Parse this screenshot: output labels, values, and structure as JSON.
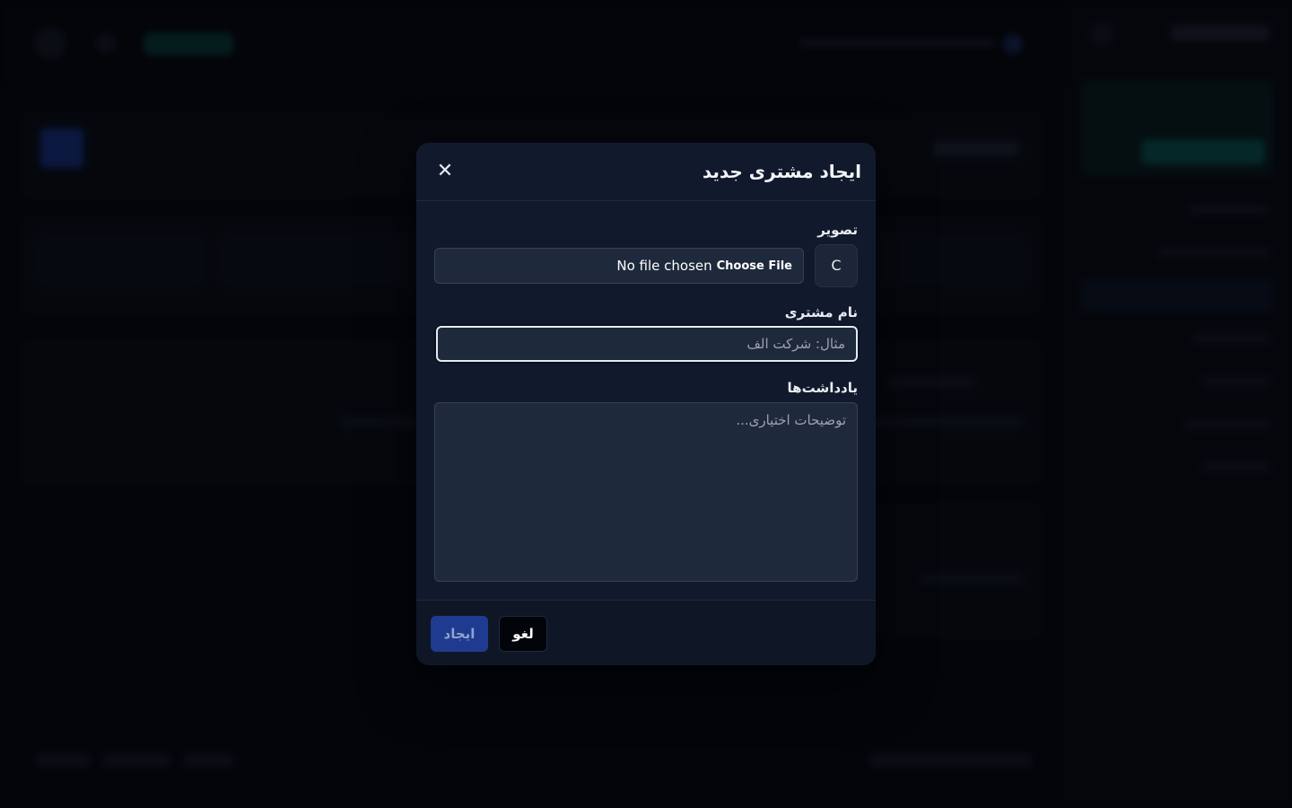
{
  "modal": {
    "title": "ایجاد مشتری جدید",
    "close_icon": "close-icon",
    "image_field": {
      "label": "تصویر",
      "avatar_letter": "C",
      "file_button": "Choose File",
      "file_status": "No file chosen"
    },
    "name_field": {
      "label": "نام مشتری",
      "placeholder": "مثال: شرکت الف",
      "value": ""
    },
    "notes_field": {
      "label": "یادداشت‌ها",
      "placeholder": "توضیحات اختیاری...",
      "value": ""
    },
    "footer": {
      "create_label": "ایجاد",
      "cancel_label": "لغو"
    }
  },
  "colors": {
    "accent_primary": "#1f3b8f",
    "modal_bg": "#111a2c",
    "input_bg": "#1e293b"
  }
}
